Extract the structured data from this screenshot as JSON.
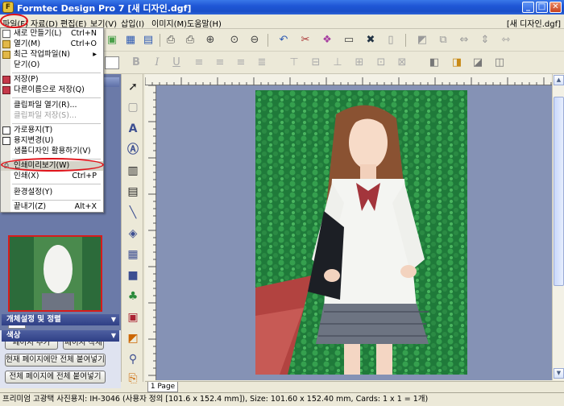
{
  "window": {
    "title": "Formtec Design Pro 7 [새 디자인.dgf]",
    "minimize": "_",
    "maximize": "□",
    "close": "✕"
  },
  "menubar": {
    "items": [
      "파일(F)",
      "자료(D)",
      "편집(E)",
      "보기(V)",
      "삽입(I)",
      "이미지(M)",
      "도움말(H)"
    ],
    "doc_name": "[새 디자인.dgf]"
  },
  "file_menu": {
    "items": [
      {
        "label": "새로 만들기(L)",
        "shortcut": "Ctrl+N",
        "icon": "new-file-icon"
      },
      {
        "label": "열기(M)",
        "shortcut": "Ctrl+O",
        "icon": "open-folder-icon"
      },
      {
        "label": "최근 작업파일(N)",
        "shortcut": "▸",
        "icon": "recent-files-icon"
      },
      {
        "label": "닫기(O)",
        "shortcut": "",
        "icon": ""
      },
      {
        "label": "저장(P)",
        "shortcut": "",
        "icon": "save-icon"
      },
      {
        "label": "다른이름으로 저장(Q)",
        "shortcut": "",
        "icon": "save-as-icon"
      },
      {
        "label": "클립파일 열기(R)...",
        "shortcut": "",
        "icon": ""
      },
      {
        "label": "클립파일 저장(S)...",
        "shortcut": "",
        "icon": "",
        "disabled": true
      },
      {
        "label": "가로용지(T)",
        "shortcut": "",
        "icon": "landscape-icon"
      },
      {
        "label": "용지변경(U)",
        "shortcut": "",
        "icon": "paper-change-icon"
      },
      {
        "label": "샘플디자인 활용하기(V)",
        "shortcut": "",
        "icon": ""
      },
      {
        "label": "인쇄미리보기(W)",
        "shortcut": "",
        "icon": "print-preview-icon"
      },
      {
        "label": "인쇄(X)",
        "shortcut": "Ctrl+P",
        "icon": ""
      },
      {
        "label": "환경설정(Y)",
        "shortcut": "",
        "icon": ""
      },
      {
        "label": "끝내기(Z)",
        "shortcut": "Alt+X",
        "icon": ""
      }
    ]
  },
  "left_panel": {
    "page_tab": "1P",
    "buttons": [
      "페이지 추가",
      "페이지 삭제",
      "현재 페이지에만 전체 붙여넣기",
      "전체 페이지에 전체 붙여넣기"
    ],
    "sections": [
      "개체설정 및 정렬",
      "색상"
    ]
  },
  "canvas": {
    "page_tab": "1 Page"
  },
  "status": {
    "text": "프리미엄 고광택 사진용지: IH-3046 (사용자 정의 [101.6 x 152.4 mm]), Size: 101.60 x 152.40 mm,  Cards: 1 x 1 = 1개)"
  },
  "colors": {
    "highlight_oval": "#e0141b",
    "panel_bg": "#6b7aa8",
    "canvas_bg": "#8592b5"
  }
}
